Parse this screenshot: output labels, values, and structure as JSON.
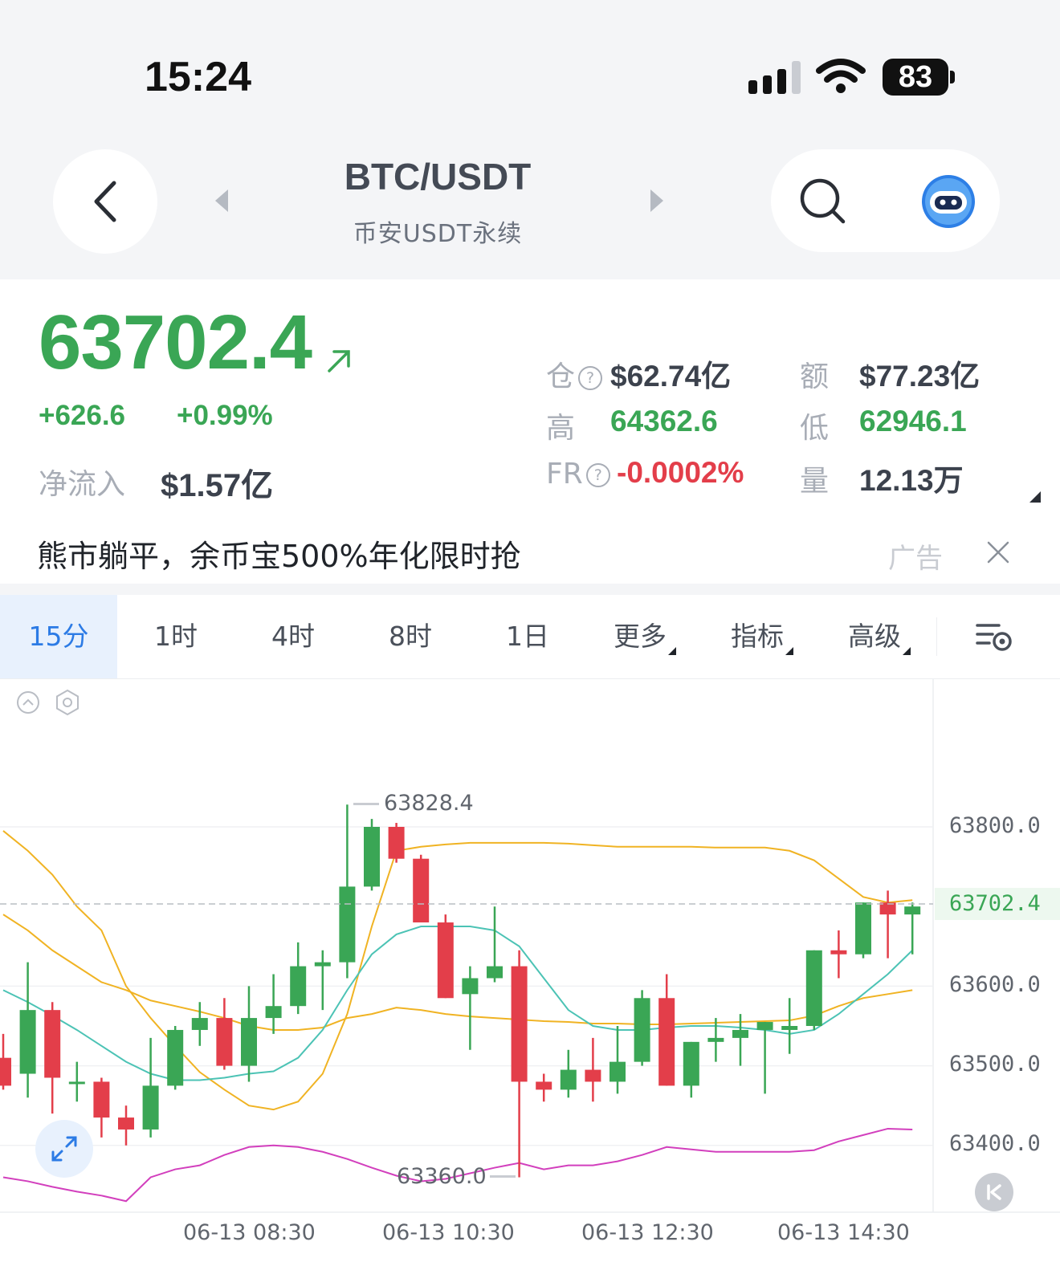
{
  "status_bar": {
    "time": "15:24",
    "battery": "83"
  },
  "header": {
    "title": "BTC/USDT",
    "subtitle": "币安USDT永续"
  },
  "price_panel": {
    "last_price": "63702.4",
    "change": "+626.6",
    "change_pct": "+0.99%",
    "net_inflow_label": "净流入",
    "net_inflow_value": "$1.57亿",
    "stats": {
      "open_interest_label": "仓",
      "open_interest_value": "$62.74亿",
      "amount_label": "额",
      "amount_value": "$77.23亿",
      "high_label": "高",
      "high_value": "64362.6",
      "low_label": "低",
      "low_value": "62946.1",
      "funding_rate_label": "FR",
      "funding_rate_value": "-0.0002%",
      "volume_label": "量",
      "volume_value": "12.13万"
    }
  },
  "ad": {
    "text": "熊市躺平，余币宝500%年化限时抢",
    "tag": "广告"
  },
  "tabs": [
    {
      "label": "15分",
      "active": true
    },
    {
      "label": "1时"
    },
    {
      "label": "4时"
    },
    {
      "label": "8时"
    },
    {
      "label": "1日"
    },
    {
      "label": "更多"
    },
    {
      "label": "指标"
    },
    {
      "label": "高级"
    }
  ],
  "colors": {
    "up": "#3aa655",
    "down": "#e33e4a",
    "accent": "#2c7be5",
    "ma_yellow": "#f0b323",
    "ma_teal": "#4cc3b5",
    "ma_pink": "#d23fbd"
  },
  "chart_data": {
    "type": "candlestick",
    "interval": "15分",
    "x_ticks": [
      "06-13 08:30",
      "06-13 10:30",
      "06-13 12:30",
      "06-13 14:30"
    ],
    "y_ticks": [
      "63800.0",
      "63702.4",
      "63600.0",
      "63500.0",
      "63400.0"
    ],
    "ylim": [
      63300,
      63890
    ],
    "current_price": "63702.4",
    "high_marker": "63828.4",
    "low_marker": "63360.0",
    "candles": [
      {
        "o": 63510,
        "h": 63540,
        "l": 63470,
        "c": 63475
      },
      {
        "o": 63490,
        "h": 63630,
        "l": 63460,
        "c": 63570
      },
      {
        "o": 63570,
        "h": 63580,
        "l": 63440,
        "c": 63485
      },
      {
        "o": 63480,
        "h": 63505,
        "l": 63455,
        "c": 63480
      },
      {
        "o": 63480,
        "h": 63485,
        "l": 63410,
        "c": 63435
      },
      {
        "o": 63435,
        "h": 63450,
        "l": 63400,
        "c": 63420
      },
      {
        "o": 63420,
        "h": 63535,
        "l": 63410,
        "c": 63475
      },
      {
        "o": 63475,
        "h": 63550,
        "l": 63470,
        "c": 63545
      },
      {
        "o": 63545,
        "h": 63580,
        "l": 63525,
        "c": 63560
      },
      {
        "o": 63560,
        "h": 63585,
        "l": 63495,
        "c": 63500
      },
      {
        "o": 63500,
        "h": 63600,
        "l": 63480,
        "c": 63560
      },
      {
        "o": 63560,
        "h": 63615,
        "l": 63540,
        "c": 63575
      },
      {
        "o": 63575,
        "h": 63655,
        "l": 63565,
        "c": 63625
      },
      {
        "o": 63625,
        "h": 63645,
        "l": 63570,
        "c": 63630
      },
      {
        "o": 63630,
        "h": 63828,
        "l": 63610,
        "c": 63725
      },
      {
        "o": 63725,
        "h": 63810,
        "l": 63720,
        "c": 63800
      },
      {
        "o": 63800,
        "h": 63805,
        "l": 63755,
        "c": 63760
      },
      {
        "o": 63760,
        "h": 63765,
        "l": 63680,
        "c": 63680
      },
      {
        "o": 63680,
        "h": 63690,
        "l": 63585,
        "c": 63585
      },
      {
        "o": 63590,
        "h": 63625,
        "l": 63520,
        "c": 63610
      },
      {
        "o": 63610,
        "h": 63700,
        "l": 63605,
        "c": 63625
      },
      {
        "o": 63625,
        "h": 63645,
        "l": 63360,
        "c": 63480
      },
      {
        "o": 63480,
        "h": 63490,
        "l": 63455,
        "c": 63470
      },
      {
        "o": 63470,
        "h": 63520,
        "l": 63460,
        "c": 63495
      },
      {
        "o": 63495,
        "h": 63535,
        "l": 63455,
        "c": 63480
      },
      {
        "o": 63480,
        "h": 63550,
        "l": 63465,
        "c": 63505
      },
      {
        "o": 63505,
        "h": 63595,
        "l": 63500,
        "c": 63585
      },
      {
        "o": 63585,
        "h": 63615,
        "l": 63475,
        "c": 63475
      },
      {
        "o": 63475,
        "h": 63530,
        "l": 63460,
        "c": 63530
      },
      {
        "o": 63530,
        "h": 63560,
        "l": 63505,
        "c": 63535
      },
      {
        "o": 63535,
        "h": 63565,
        "l": 63500,
        "c": 63545
      },
      {
        "o": 63545,
        "h": 63555,
        "l": 63465,
        "c": 63555
      },
      {
        "o": 63545,
        "h": 63585,
        "l": 63515,
        "c": 63550
      },
      {
        "o": 63550,
        "h": 63645,
        "l": 63545,
        "c": 63645
      },
      {
        "o": 63645,
        "h": 63670,
        "l": 63610,
        "c": 63640
      },
      {
        "o": 63640,
        "h": 63705,
        "l": 63635,
        "c": 63705
      },
      {
        "o": 63705,
        "h": 63720,
        "l": 63635,
        "c": 63690
      },
      {
        "o": 63690,
        "h": 63705,
        "l": 63640,
        "c": 63700
      }
    ],
    "series": [
      {
        "values": [
          63795,
          63770,
          63740,
          63700,
          63670,
          63600,
          63560,
          63525,
          63492,
          63470,
          63450,
          63445,
          63455,
          63490,
          63565,
          63675,
          63770,
          63775,
          63778,
          63780,
          63780,
          63780,
          63780,
          63779,
          63777,
          63775,
          63775,
          63775,
          63775,
          63774,
          63774,
          63774,
          63770,
          63758,
          63735,
          63712,
          63705,
          63708
        ]
      },
      {
        "values": [
          63690,
          63670,
          63645,
          63625,
          63605,
          63595,
          63582,
          63575,
          63568,
          63560,
          63550,
          63545,
          63545,
          63548,
          63560,
          63565,
          63573,
          63570,
          63565,
          63562,
          63560,
          63558,
          63556,
          63555,
          63553,
          63553,
          63552,
          63552,
          63553,
          63554,
          63555,
          63556,
          63557,
          63563,
          63575,
          63585,
          63590,
          63595
        ]
      },
      {
        "values": [
          63595,
          63580,
          63563,
          63545,
          63525,
          63505,
          63490,
          63482,
          63482,
          63485,
          63490,
          63493,
          63510,
          63545,
          63595,
          63640,
          63665,
          63675,
          63675,
          63675,
          63670,
          63650,
          63610,
          63570,
          63550,
          63545,
          63545,
          63548,
          63550,
          63550,
          63548,
          63545,
          63540,
          63545,
          63565,
          63590,
          63615,
          63645
        ]
      },
      {
        "values": [
          63360,
          63355,
          63348,
          63342,
          63337,
          63330,
          63360,
          63370,
          63375,
          63388,
          63398,
          63400,
          63398,
          63392,
          63383,
          63372,
          63362,
          63355,
          63358,
          63365,
          63372,
          63378,
          63370,
          63375,
          63375,
          63380,
          63388,
          63398,
          63395,
          63392,
          63392,
          63392,
          63392,
          63394,
          63405,
          63413,
          63421,
          63420
        ]
      }
    ]
  }
}
